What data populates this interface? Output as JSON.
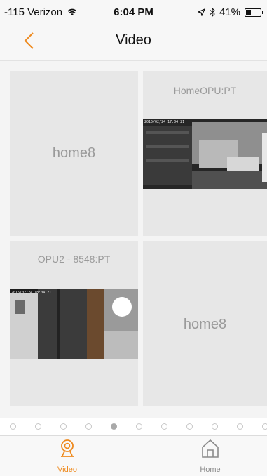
{
  "status_bar": {
    "carrier": "-115 Verizon",
    "time": "6:04 PM",
    "battery": "41%",
    "battery_level": 0.41
  },
  "nav": {
    "title": "Video",
    "back_icon": "chevron-left-icon"
  },
  "tiles": [
    {
      "name": "home8",
      "has_preview": false
    },
    {
      "name": "HomeOPU:PT",
      "has_preview": true,
      "timestamp": "2015/02/24 17:04:21"
    },
    {
      "name": "OPU2 - 8548:PT",
      "has_preview": true,
      "timestamp": "2015/02/24 18:04:21"
    },
    {
      "name": "home8",
      "has_preview": false
    }
  ],
  "pagination": {
    "total": 11,
    "current_index": 4
  },
  "tab_bar": {
    "tabs": [
      {
        "label": "Video",
        "icon": "video-icon",
        "active": true
      },
      {
        "label": "Home",
        "icon": "home-icon",
        "active": false
      }
    ]
  },
  "colors": {
    "accent": "#ee8a1f",
    "inactive": "#8a8a8a",
    "tile_background": "#e7e7e7"
  }
}
